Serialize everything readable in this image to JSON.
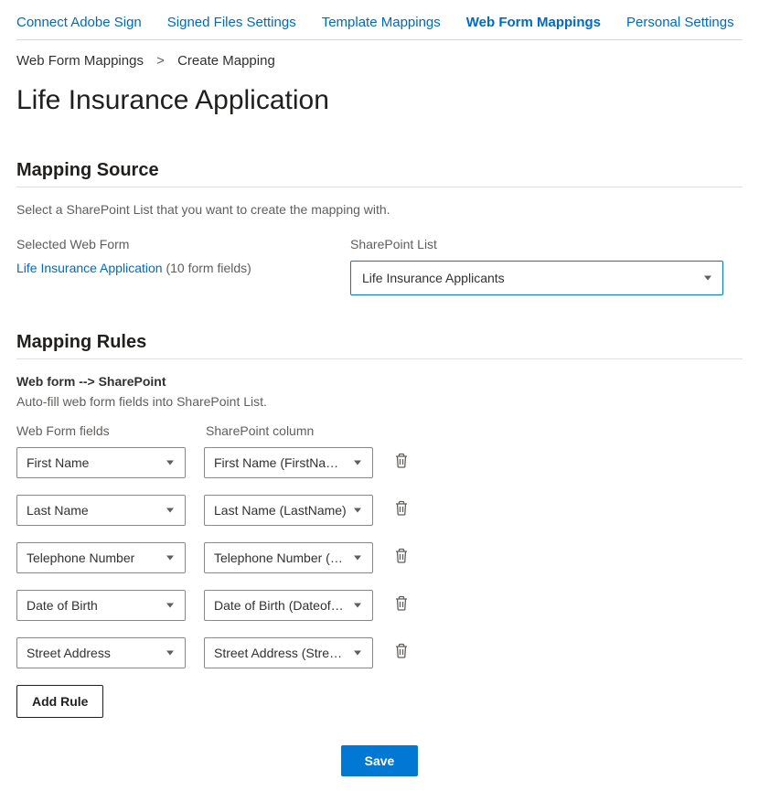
{
  "tabs": [
    "Connect Adobe Sign",
    "Signed Files Settings",
    "Template Mappings",
    "Web Form Mappings",
    "Personal Settings"
  ],
  "tabs_active_index": 3,
  "breadcrumb": {
    "root": "Web Form Mappings",
    "sep": ">",
    "current": "Create Mapping"
  },
  "page_title": "Life Insurance Application",
  "source": {
    "heading": "Mapping Source",
    "desc": "Select a SharePoint List that you want to create the mapping with.",
    "selected_label": "Selected Web Form",
    "webform_name": "Life Insurance Application",
    "webform_count": "(10 form fields)",
    "sp_label": "SharePoint List",
    "sp_value": "Life Insurance Applicants"
  },
  "rules": {
    "heading": "Mapping Rules",
    "sub": "Web form --> SharePoint",
    "desc": "Auto-fill web form fields into SharePoint List.",
    "col1": "Web Form fields",
    "col2": "SharePoint column",
    "rows": [
      {
        "field": "First Name",
        "column": "First Name (FirstName)"
      },
      {
        "field": "Last Name",
        "column": "Last Name (LastName)"
      },
      {
        "field": "Telephone Number",
        "column": "Telephone Number (Tele…"
      },
      {
        "field": "Date of Birth",
        "column": "Date of Birth (DateofBirth)"
      },
      {
        "field": "Street Address",
        "column": "Street Address (StreetAd…"
      }
    ],
    "add_label": "Add Rule"
  },
  "save_label": "Save"
}
